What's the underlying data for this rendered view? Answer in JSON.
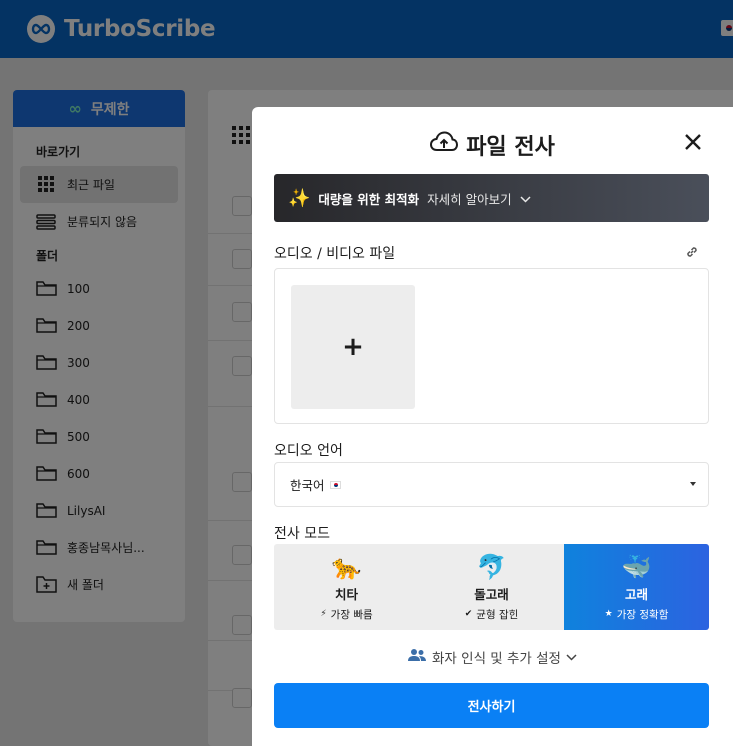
{
  "app": {
    "brand": "TurboScribe"
  },
  "sidebar": {
    "plan_label": "무제한",
    "shortcuts_header": "바로가기",
    "shortcuts": [
      {
        "label": "최근 파일",
        "icon": "grid-icon",
        "active": true
      },
      {
        "label": "분류되지 않음",
        "icon": "stack-icon",
        "active": false
      }
    ],
    "folders_header": "폴더",
    "folders": [
      {
        "label": "100"
      },
      {
        "label": "200"
      },
      {
        "label": "300"
      },
      {
        "label": "400"
      },
      {
        "label": "500"
      },
      {
        "label": "600"
      },
      {
        "label": "LilysAI"
      },
      {
        "label": "홍종남목사님..."
      }
    ],
    "new_folder_label": "새 폴더"
  },
  "modal": {
    "title": "파일 전사",
    "banner": {
      "strong": "대량을 위한 최적화",
      "more": "자세히 알아보기"
    },
    "file_label": "오디오 / 비디오 파일",
    "add_symbol": "+",
    "language_label": "오디오 언어",
    "language_value": "한국어",
    "mode_label": "전사 모드",
    "modes": [
      {
        "emoji": "🐆",
        "name": "치타",
        "sub_icon": "⚡",
        "sub": "가장 빠름",
        "selected": false
      },
      {
        "emoji": "🐬",
        "name": "돌고래",
        "sub_icon": "✔",
        "sub": "균형 잡힌",
        "selected": false
      },
      {
        "emoji": "🐳",
        "name": "고래",
        "sub_icon": "★",
        "sub": "가장 정확함",
        "selected": true
      }
    ],
    "advanced_label": "화자 인식 및 추가 설정",
    "submit_label": "전사하기"
  },
  "colors": {
    "header": "#0866c6",
    "submit": "#0a80f5",
    "selected_mode_start": "#0f82dd",
    "selected_mode_end": "#2c63e0"
  }
}
